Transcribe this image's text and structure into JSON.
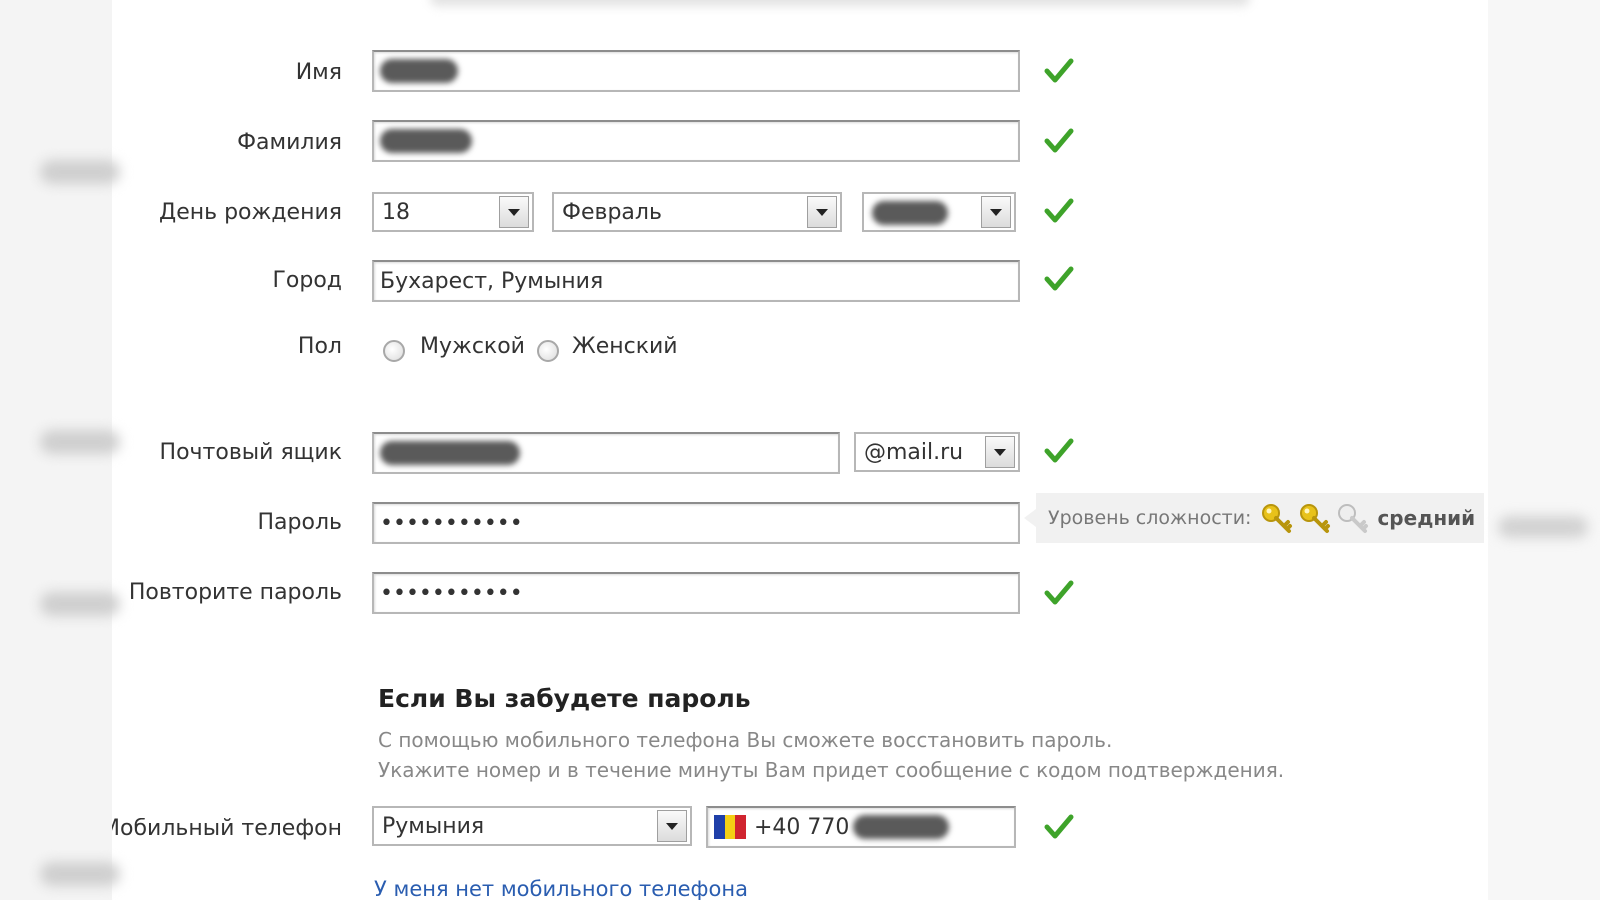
{
  "form": {
    "first_name": {
      "label": "Имя"
    },
    "last_name": {
      "label": "Фамилия"
    },
    "birthday": {
      "label": "День рождения",
      "day": "18",
      "month": "Февраль"
    },
    "city": {
      "label": "Город",
      "value": "Бухарест, Румыния"
    },
    "gender": {
      "label": "Пол",
      "options": [
        "Мужской",
        "Женский"
      ]
    },
    "mailbox": {
      "label": "Почтовый ящик",
      "domain": "@mail.ru"
    },
    "password": {
      "label": "Пароль",
      "value": "•••••••••••",
      "strength_label": "Уровень сложности:",
      "strength_value": "средний",
      "strength_keys_filled": 2,
      "strength_keys_total": 3
    },
    "password_repeat": {
      "label": "Повторите пароль",
      "value": "•••••••••••"
    }
  },
  "recovery": {
    "title": "Если Вы забудете пароль",
    "hint_line1": "С помощью мобильного телефона Вы сможете восстановить пароль.",
    "hint_line2": "Укажите номер и в течение минуты Вам придет сообщение с кодом подтверждения.",
    "phone_label": "Мобильный телефон",
    "country": "Румыния",
    "phone_prefix": "+40 770",
    "no_phone_link": "У меня нет мобильного телефона"
  },
  "colors": {
    "check": "#3ea32a",
    "key_filled": "#e8c21a",
    "key_empty": "#c9c9c9",
    "link": "#2a5db0",
    "flag_blue": "#1f3fa8",
    "flag_yellow": "#f4cf14",
    "flag_red": "#d0242f"
  },
  "icons": [
    "checkmark-icon",
    "key-icon",
    "dropdown-arrow-icon",
    "flag-romania-icon"
  ]
}
